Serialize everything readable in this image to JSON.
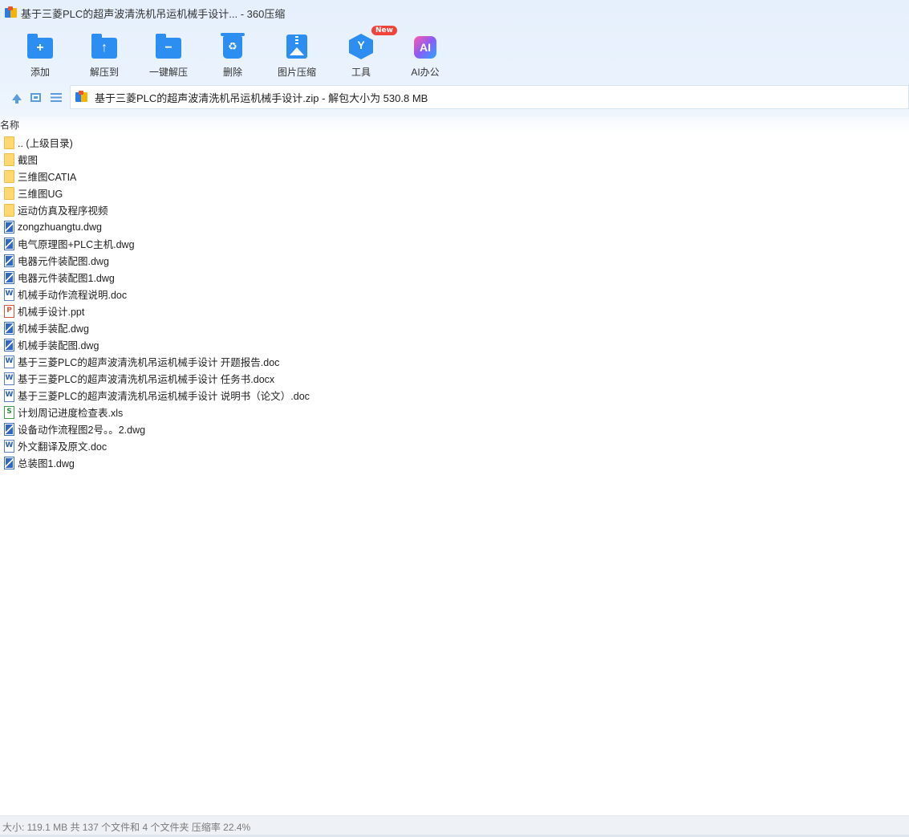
{
  "window": {
    "title": "基于三菱PLC的超声波清洗机吊运机械手设计... - 360压缩"
  },
  "toolbar": {
    "items": [
      {
        "label": "添加",
        "icon": "add-folder-icon"
      },
      {
        "label": "解压到",
        "icon": "extract-folder-icon"
      },
      {
        "label": "一键解压",
        "icon": "one-click-extract-icon"
      },
      {
        "label": "删除",
        "icon": "recycle-bin-icon"
      },
      {
        "label": "图片压缩",
        "icon": "image-compress-icon"
      },
      {
        "label": "工具",
        "icon": "tools-icon",
        "badge": "New"
      },
      {
        "label": "AI办公",
        "icon": "ai-office-icon",
        "glyph": "AI"
      }
    ]
  },
  "navbar": {
    "path": "基于三菱PLC的超声波清洗机吊运机械手设计.zip - 解包大小为 530.8 MB"
  },
  "list": {
    "column_name": "名称",
    "items": [
      {
        "name": ".. (上级目录)",
        "type": "folder"
      },
      {
        "name": "截图",
        "type": "folder"
      },
      {
        "name": "三维图CATIA",
        "type": "folder"
      },
      {
        "name": "三维图UG",
        "type": "folder"
      },
      {
        "name": "运动仿真及程序视频",
        "type": "folder"
      },
      {
        "name": "zongzhuangtu.dwg",
        "type": "dwg"
      },
      {
        "name": "电气原理图+PLC主机.dwg",
        "type": "dwg"
      },
      {
        "name": "电器元件装配图.dwg",
        "type": "dwg"
      },
      {
        "name": "电器元件装配图1.dwg",
        "type": "dwg"
      },
      {
        "name": "机械手动作流程说明.doc",
        "type": "doc"
      },
      {
        "name": "机械手设计.ppt",
        "type": "ppt"
      },
      {
        "name": "机械手装配.dwg",
        "type": "dwg"
      },
      {
        "name": "机械手装配图.dwg",
        "type": "dwg"
      },
      {
        "name": "基于三菱PLC的超声波清洗机吊运机械手设计 开题报告.doc",
        "type": "doc"
      },
      {
        "name": "基于三菱PLC的超声波清洗机吊运机械手设计 任务书.docx",
        "type": "doc"
      },
      {
        "name": "基于三菱PLC的超声波清洗机吊运机械手设计 说明书（论文）.doc",
        "type": "doc"
      },
      {
        "name": "计划周记进度检查表.xls",
        "type": "xls"
      },
      {
        "name": "设备动作流程图2号。。2.dwg",
        "type": "dwg"
      },
      {
        "name": "外文翻译及原文.doc",
        "type": "doc"
      },
      {
        "name": "总装图1.dwg",
        "type": "dwg"
      }
    ]
  },
  "status": {
    "text": "大小: 119.1 MB 共 137 个文件和 4 个文件夹 压缩率 22.4%"
  }
}
